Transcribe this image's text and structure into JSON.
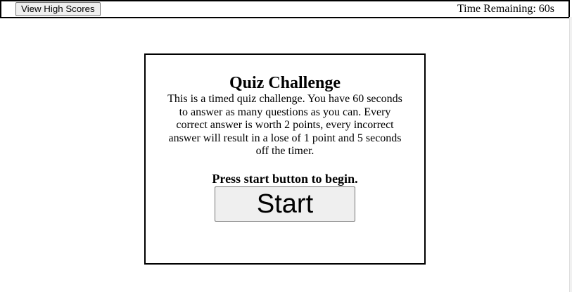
{
  "header": {
    "high_scores_label": "View High Scores",
    "timer_text": "Time Remaining: 60s"
  },
  "quiz": {
    "title": "Quiz Challenge",
    "description": "This is a timed quiz challenge. You have 60 seconds to answer as many questions as you can. Every correct answer is worth 2 points, every incorrect answer will result in a lose of 1 point and 5 seconds off the timer.",
    "prompt": "Press start button to begin.",
    "start_label": "Start"
  },
  "colors": {
    "background": "#ffffff",
    "border": "#000000",
    "button_bg": "#efefef",
    "button_border": "#767676"
  }
}
